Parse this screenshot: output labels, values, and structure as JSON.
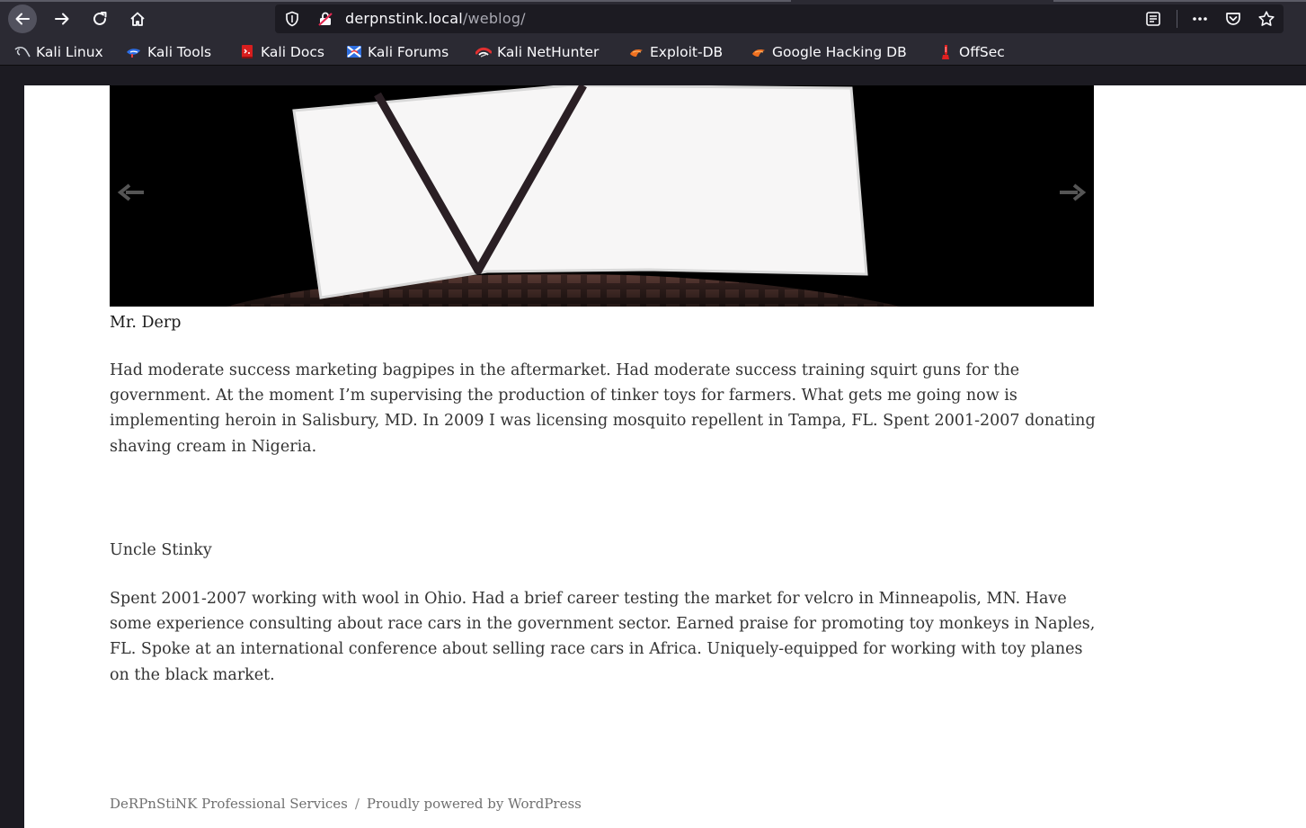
{
  "browser": {
    "url_host": "derpnstink.local",
    "url_path": "/weblog/",
    "bookmarks": [
      {
        "label": "Kali Linux",
        "icon": "kali-dragon-icon"
      },
      {
        "label": "Kali Tools",
        "icon": "kali-tools-icon"
      },
      {
        "label": "Kali Docs",
        "icon": "kali-docs-icon"
      },
      {
        "label": "Kali Forums",
        "icon": "kali-forums-icon"
      },
      {
        "label": "Kali NetHunter",
        "icon": "kali-nethunter-icon"
      },
      {
        "label": "Exploit-DB",
        "icon": "exploit-db-icon"
      },
      {
        "label": "Google Hacking DB",
        "icon": "ghdb-icon"
      },
      {
        "label": "OffSec",
        "icon": "offsec-icon"
      }
    ]
  },
  "post": {
    "caption": "Mr. Derp",
    "bio": "Had moderate success marketing bagpipes in the aftermarket. Had moderate success training squirt guns for the government. At the moment I’m supervising the production of tinker toys for farmers. What gets me going now is implementing heroin in Salisbury, MD. In 2009 I was licensing mosquito repellent in Tampa, FL. Spent 2001-2007 donating shaving cream in Nigeria.",
    "name2": "Uncle Stinky",
    "bio2": "Spent 2001-2007 working with wool in Ohio. Had a brief career testing the market for velcro in Minneapolis, MN. Have some experience consulting about race cars in the government sector. Earned praise for promoting toy monkeys in Naples, FL. Spoke at an international conference about selling race cars in Africa. Uniquely-equipped for working with toy planes on the black market."
  },
  "footer": {
    "site_name": "DeRPnStiNK Professional Services",
    "separator": "/",
    "powered": "Proudly powered by WordPress"
  }
}
